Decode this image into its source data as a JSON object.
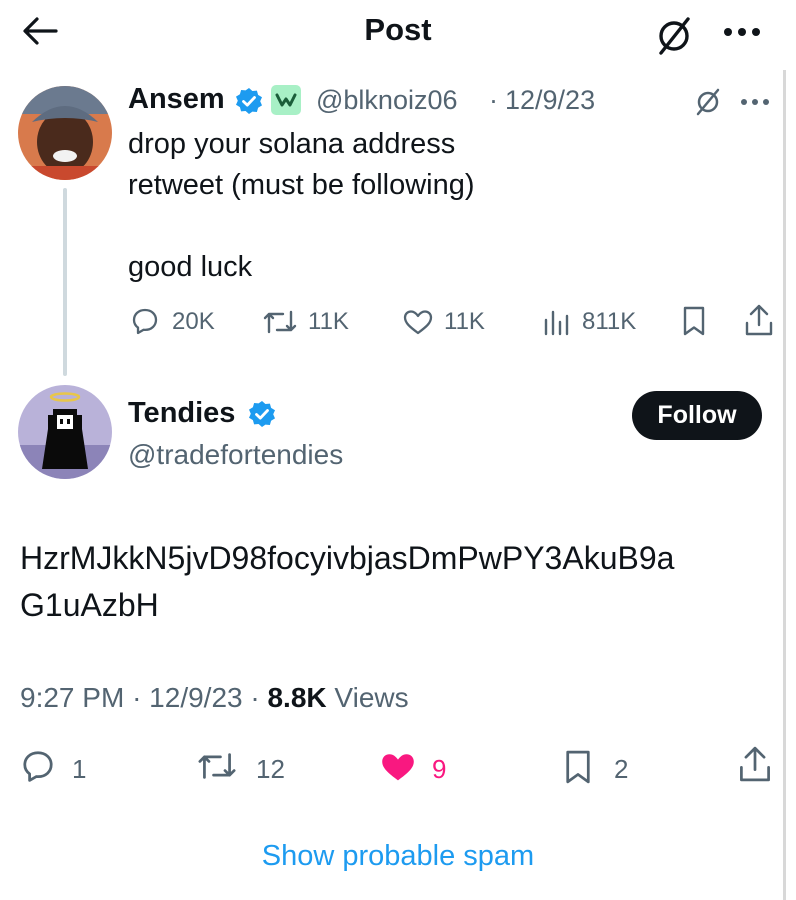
{
  "header": {
    "title": "Post",
    "back_icon": "arrow-left-icon",
    "grok_icon": "grok-icon",
    "more_icon": "more-dots-icon"
  },
  "parent_post": {
    "author_name": "Ansem",
    "handle": "@blknoiz06",
    "date": "12/9/23",
    "text_lines": [
      "drop your solana address",
      "retweet (must be following)",
      "",
      "good luck"
    ],
    "stats": {
      "replies": "20K",
      "reposts": "11K",
      "likes": "11K",
      "views": "811K"
    }
  },
  "reply_post": {
    "author_name": "Tendies",
    "handle": "@tradefortendies",
    "follow_label": "Follow",
    "text_lines": [
      "HzrMJkkN5jvD98focyivbjasDmPwPY3AkuB9a",
      "G1uAzbH"
    ],
    "time": "9:27 PM",
    "date": "12/9/23",
    "views_count": "8.8K",
    "views_label": "Views",
    "stats": {
      "replies": "1",
      "reposts": "12",
      "likes": "9",
      "bookmarks": "2"
    }
  },
  "footer": {
    "spam_link": "Show probable spam"
  },
  "colors": {
    "accent": "#1d9bf0",
    "like": "#f91880",
    "verified": "#1d9bf0",
    "text": "#0f1419",
    "muted": "#536471"
  }
}
